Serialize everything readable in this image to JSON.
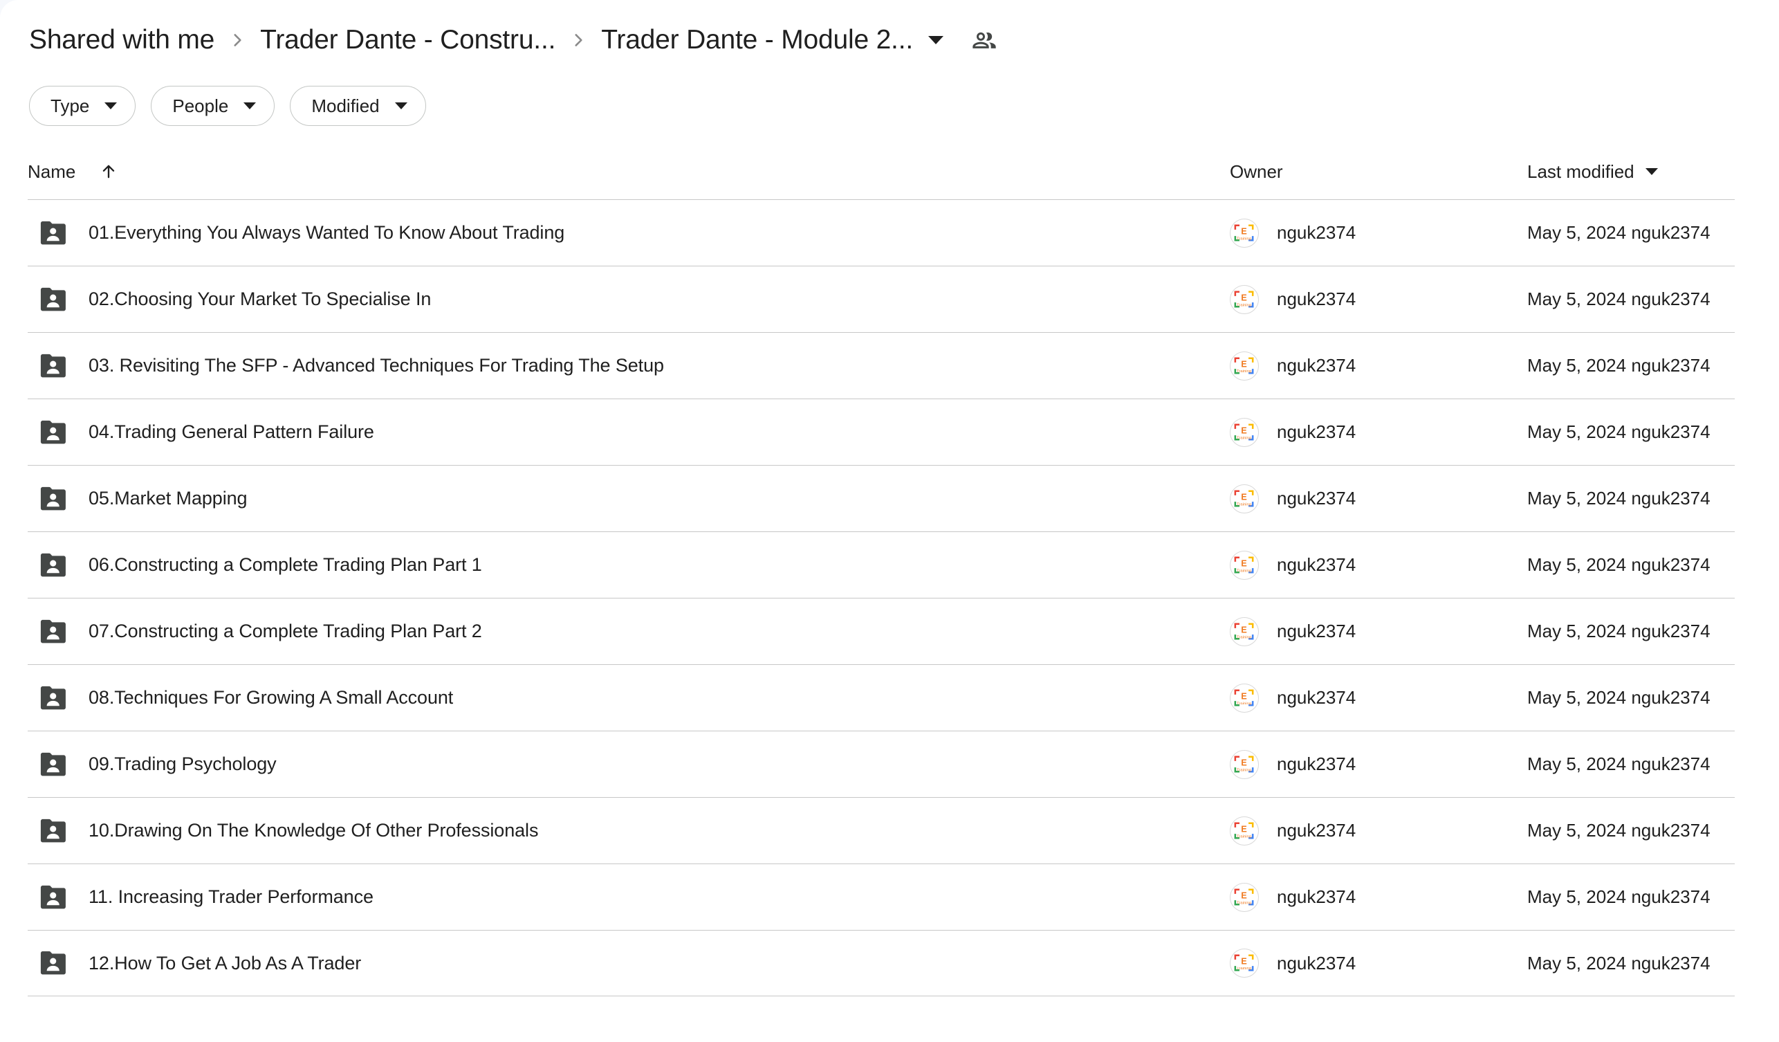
{
  "breadcrumb": {
    "items": [
      {
        "label": "Shared with me"
      },
      {
        "label": "Trader Dante - Constru..."
      },
      {
        "label": "Trader Dante - Module 2..."
      }
    ],
    "caret_icon": "chevron-down-icon",
    "separator_icon": "chevron-right-icon",
    "people_icon": "people-shared-icon"
  },
  "filters": [
    {
      "label": "Type",
      "icon": "chevron-down-icon"
    },
    {
      "label": "People",
      "icon": "chevron-down-icon"
    },
    {
      "label": "Modified",
      "icon": "chevron-down-icon"
    }
  ],
  "columns": {
    "name": "Name",
    "name_sort_icon": "arrow-up-icon",
    "owner": "Owner",
    "last_modified": "Last modified",
    "last_modified_icon": "chevron-down-icon"
  },
  "colors": {
    "folder_icon": "#444746",
    "divider": "#c7c7c7",
    "text": "#1f1f1f",
    "chip_border": "#c4c7c5",
    "avatar_red": "#ea4335",
    "avatar_yellow": "#fbbc04",
    "avatar_green": "#34a853",
    "avatar_blue": "#4285f4",
    "avatar_letter": "#f07b22"
  },
  "avatar": {
    "letter": "E",
    "sublabel": "Training",
    "icon": "e-training-logo-icon"
  },
  "rows": [
    {
      "name": "01.Everything You Always Wanted To Know About Trading",
      "owner": "nguk2374",
      "modified": "May 5, 2024 nguk2374",
      "icon": "shared-folder-icon"
    },
    {
      "name": "02.Choosing Your Market To Specialise In",
      "owner": "nguk2374",
      "modified": "May 5, 2024 nguk2374",
      "icon": "shared-folder-icon"
    },
    {
      "name": "03. Revisiting The SFP - Advanced Techniques For Trading The Setup",
      "owner": "nguk2374",
      "modified": "May 5, 2024 nguk2374",
      "icon": "shared-folder-icon"
    },
    {
      "name": "04.Trading General Pattern Failure",
      "owner": "nguk2374",
      "modified": "May 5, 2024 nguk2374",
      "icon": "shared-folder-icon"
    },
    {
      "name": "05.Market Mapping",
      "owner": "nguk2374",
      "modified": "May 5, 2024 nguk2374",
      "icon": "shared-folder-icon"
    },
    {
      "name": "06.Constructing a Complete Trading Plan Part 1",
      "owner": "nguk2374",
      "modified": "May 5, 2024 nguk2374",
      "icon": "shared-folder-icon"
    },
    {
      "name": "07.Constructing a Complete Trading Plan Part 2",
      "owner": "nguk2374",
      "modified": "May 5, 2024 nguk2374",
      "icon": "shared-folder-icon"
    },
    {
      "name": "08.Techniques For Growing A Small Account",
      "owner": "nguk2374",
      "modified": "May 5, 2024 nguk2374",
      "icon": "shared-folder-icon"
    },
    {
      "name": "09.Trading Psychology",
      "owner": "nguk2374",
      "modified": "May 5, 2024 nguk2374",
      "icon": "shared-folder-icon"
    },
    {
      "name": "10.Drawing On The Knowledge Of Other Professionals",
      "owner": "nguk2374",
      "modified": "May 5, 2024 nguk2374",
      "icon": "shared-folder-icon"
    },
    {
      "name": "11. Increasing Trader Performance",
      "owner": "nguk2374",
      "modified": "May 5, 2024 nguk2374",
      "icon": "shared-folder-icon"
    },
    {
      "name": "12.How To Get A Job As A Trader",
      "owner": "nguk2374",
      "modified": "May 5, 2024 nguk2374",
      "icon": "shared-folder-icon"
    }
  ]
}
